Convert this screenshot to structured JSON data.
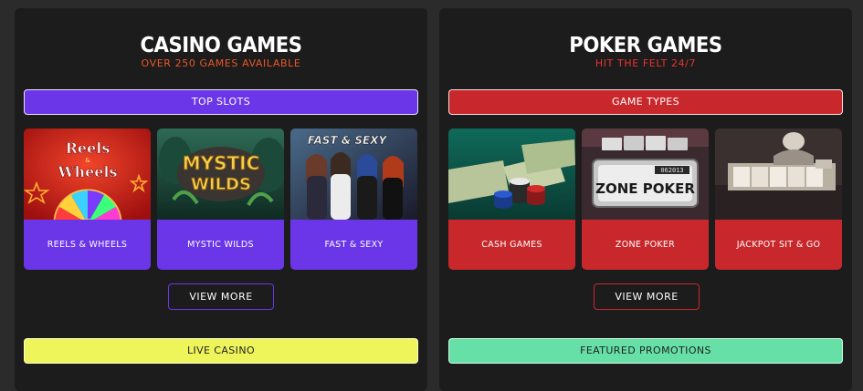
{
  "colors": {
    "casino_accent": "#6b36e8",
    "casino_subtitle": "#e8562a",
    "poker_accent": "#c8282b",
    "poker_subtitle": "#e8342f",
    "live_casino": "#eef55a",
    "featured_promotions": "#66e0a6"
  },
  "casino": {
    "title": "CASINO GAMES",
    "subtitle": "OVER 250 GAMES AVAILABLE",
    "category_label": "TOP SLOTS",
    "games": [
      {
        "label": "REELS & WHEELS",
        "logo_line1": "Reels",
        "logo_amp": "&",
        "logo_line2": "Wheels"
      },
      {
        "label": "MYSTIC WILDS",
        "logo_line1": "MYSTIC",
        "logo_line2": "WILDS"
      },
      {
        "label": "FAST & SEXY",
        "logo_line1": "FAST & SEXY"
      }
    ],
    "view_more": "VIEW MORE",
    "next_section": "LIVE CASINO"
  },
  "poker": {
    "title": "POKER GAMES",
    "subtitle": "HIT THE FELT 24/7",
    "category_label": "GAME TYPES",
    "games": [
      {
        "label": "CASH GAMES"
      },
      {
        "label": "ZONE POKER",
        "logo_text": "ZONE POKER",
        "plate_number": "062013"
      },
      {
        "label": "JACKPOT SIT & GO"
      }
    ],
    "view_more": "VIEW MORE",
    "next_section": "FEATURED PROMOTIONS"
  }
}
